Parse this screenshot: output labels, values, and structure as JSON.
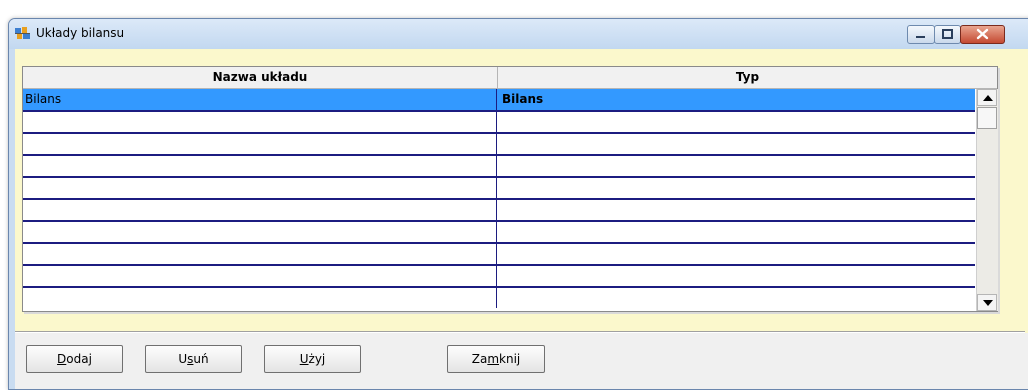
{
  "window": {
    "title": "Układy bilansu",
    "icon": "app-icon",
    "controls": [
      "minimize-icon",
      "maximize-icon",
      "close-icon"
    ]
  },
  "grid": {
    "columns": [
      {
        "label": "Nazwa układu"
      },
      {
        "label": "Typ"
      }
    ],
    "rows": [
      {
        "name": "Bilans",
        "type": "Bilans",
        "selected": true
      },
      {
        "name": "",
        "type": ""
      },
      {
        "name": "",
        "type": ""
      },
      {
        "name": "",
        "type": ""
      },
      {
        "name": "",
        "type": ""
      },
      {
        "name": "",
        "type": ""
      },
      {
        "name": "",
        "type": ""
      },
      {
        "name": "",
        "type": ""
      },
      {
        "name": "",
        "type": ""
      },
      {
        "name": "",
        "type": ""
      }
    ]
  },
  "buttons": {
    "dodaj": {
      "before": "",
      "accel": "D",
      "after": "odaj"
    },
    "usun": {
      "before": "U",
      "accel": "s",
      "after": "uń"
    },
    "uzyj": {
      "before": "",
      "accel": "U",
      "after": "żyj"
    },
    "zamknij": {
      "before": "Za",
      "accel": "m",
      "after": "knij"
    }
  },
  "colors": {
    "selection": "#3399ff",
    "grid_lines": "#1c1c80",
    "client_bg": "#fbf8cc"
  }
}
